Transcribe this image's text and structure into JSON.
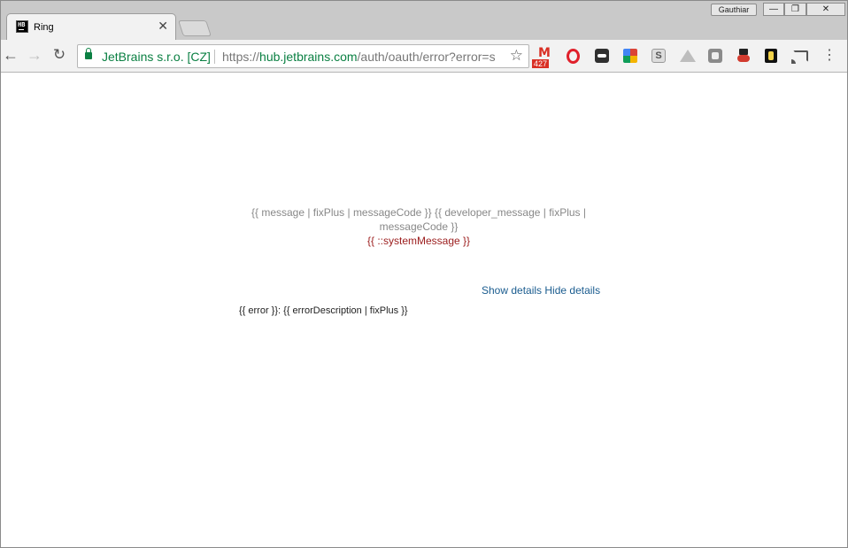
{
  "browser": {
    "tab": {
      "favicon_text": "HB",
      "title": "Ring",
      "close_label": "✕"
    },
    "profile_name": "Gauthiar",
    "window_controls": {
      "minimize": "—",
      "maximize": "❐",
      "close": "✕"
    },
    "omnibox": {
      "org": "JetBrains s.r.o. [CZ]",
      "url_scheme": "https://",
      "url_host": "hub.jetbrains.com",
      "url_path": "/auth/oauth/error?error=s"
    },
    "nav": {
      "back": "←",
      "forward": "→",
      "reload": "↻",
      "star": "☆",
      "menu": "⋮"
    },
    "extensions": [
      {
        "icon": "gmail-icon",
        "badge": "427"
      },
      {
        "icon": "opera-icon"
      },
      {
        "icon": "extension-icon"
      },
      {
        "icon": "color-picker-icon"
      },
      {
        "icon": "s-extension-icon",
        "text": "S"
      },
      {
        "icon": "google-drive-icon"
      },
      {
        "icon": "extension-icon"
      },
      {
        "icon": "spy-hat-icon"
      },
      {
        "icon": "key-icon"
      },
      {
        "icon": "cast-icon"
      }
    ]
  },
  "page": {
    "message": "{{ message | fixPlus | messageCode }} {{ developer_message | fixPlus | messageCode }}",
    "system_message": "{{ ::systemMessage }}",
    "show_details": "Show details",
    "hide_details": "Hide details",
    "error_line": "{{ error }}: {{ errorDescription | fixPlus }}"
  },
  "colors": {
    "ssl_green": "#0b8043",
    "system_message_red": "#9b1c1c",
    "link_blue": "#1a5c8f",
    "muted_text": "#888888"
  }
}
